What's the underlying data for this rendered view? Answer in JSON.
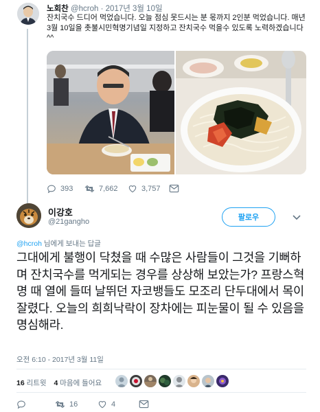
{
  "parent_tweet": {
    "name": "노회찬",
    "handle": "@hcroh",
    "separator": "·",
    "date": "2017년 3월 10일",
    "text": "잔치국수 드디어 먹었습니다. 오늘 점심 못드시는 분 몫까지 2인분 먹었습니다. 매년 3월 10일을 촛불시민혁명기념일 지정하고 잔치국수 먹을수 있도록 노력하겠습니다^^",
    "actions": {
      "reply_count": "393",
      "retweet_count": "7,662",
      "like_count": "3,757"
    }
  },
  "main_tweet": {
    "name": "이강호",
    "handle": "@21gangho",
    "follow_label": "팔로우",
    "reply_to_handle": "@hcroh",
    "reply_to_suffix": " 님에게 보내는 답글",
    "text": "그대에게 불행이 닥쳤을 때 수많은 사람들이 그것을 기뻐하며 잔치국수를 먹게되는 경우를 상상해 보았는가? 프랑스혁명 때 열에 들떠 날뛰던 자코뱅들도 모조리 단두대에서 목이 잘렸다. 오늘의 희희낙락이 장차에는 피눈물이 될 수 있음을 명심해라.",
    "timestamp": "오전 6:10 - 2017년 3월 11일",
    "stats": {
      "retweets_count": "16",
      "retweets_label": "리트윗",
      "likes_count": "4",
      "likes_label": "마음에 들어요"
    },
    "actions": {
      "retweet_count": "16",
      "like_count": "4"
    }
  },
  "colors": {
    "accent": "#1da1f2",
    "muted": "#657786",
    "text": "#14171a",
    "border": "#e6ecf0"
  },
  "icons": [
    "reply-icon",
    "retweet-icon",
    "heart-icon",
    "mail-icon",
    "chevron-down-icon"
  ]
}
